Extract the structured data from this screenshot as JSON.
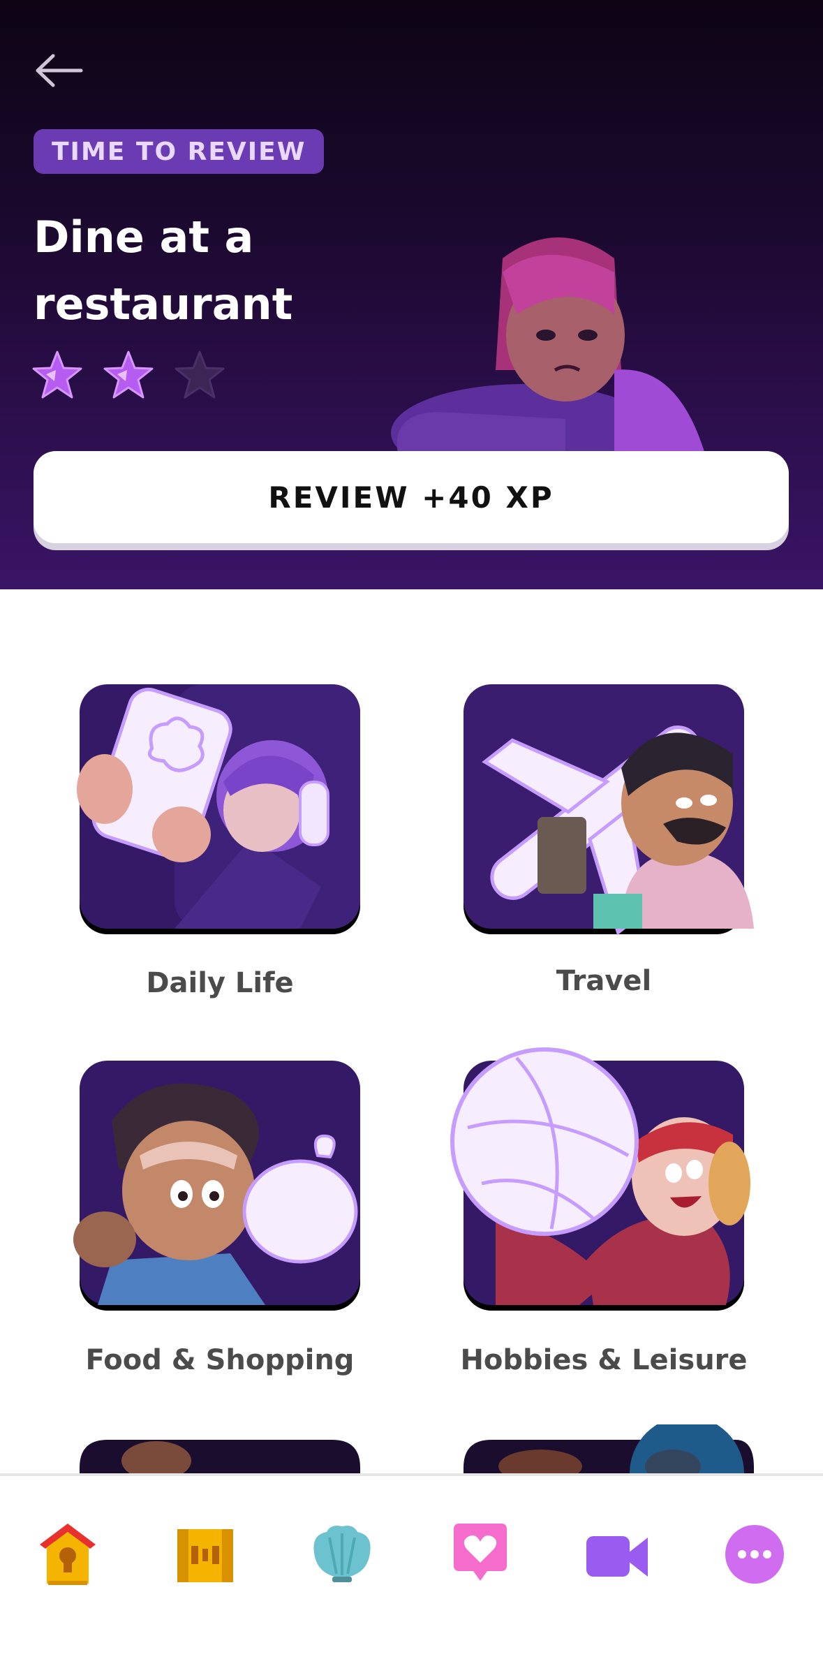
{
  "header": {
    "badge": "TIME TO REVIEW",
    "title": "Dine at a restaurant",
    "stars_filled": 2,
    "stars_total": 3,
    "review_button": "REVIEW +40 XP"
  },
  "categories": [
    {
      "label": "Daily Life"
    },
    {
      "label": "Travel"
    },
    {
      "label": "Food & Shopping"
    },
    {
      "label": "Hobbies & Leisure"
    }
  ],
  "tabbar": {
    "items": [
      "home-icon",
      "chest-icon",
      "shell-icon",
      "speech-heart-icon",
      "video-icon",
      "more-icon"
    ]
  },
  "colors": {
    "hero_top": "#0d0414",
    "hero_bottom": "#3a1466",
    "accent_purple": "#b36bff",
    "badge_bg": "#6b3bb3"
  }
}
